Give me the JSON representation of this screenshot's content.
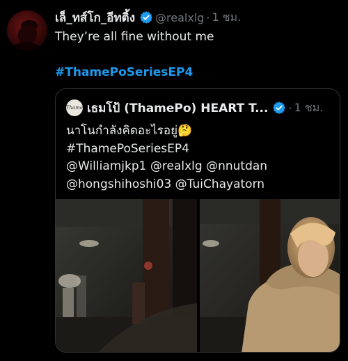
{
  "tweet": {
    "display_name": "เล็_ทส์โก_อีทติ้ง",
    "handle": "@realxlg",
    "separator": "·",
    "time": "1 ชม.",
    "text": "They’re all fine without me",
    "hashtag": "#ThamePoSeriesEP4"
  },
  "quote": {
    "display_name": "เธมโป้ (ThamePo) HEART T...",
    "separator": "·",
    "time": "1 ชม.",
    "lines": [
      "นาโนกำลังคิดอะไรอยู่🤔",
      "#ThamePoSeriesEP4",
      "@Williamjkp1 @realxlg @nnutdan",
      "@hongshihoshi03 @TuiChayatorn"
    ],
    "avatar_text": "Thame"
  },
  "colors": {
    "background": "#000000",
    "text": "#e7e9ea",
    "muted": "#71767b",
    "link": "#1d9bf0",
    "border": "#2f3336"
  },
  "icons": [
    "verified-badge-icon"
  ]
}
